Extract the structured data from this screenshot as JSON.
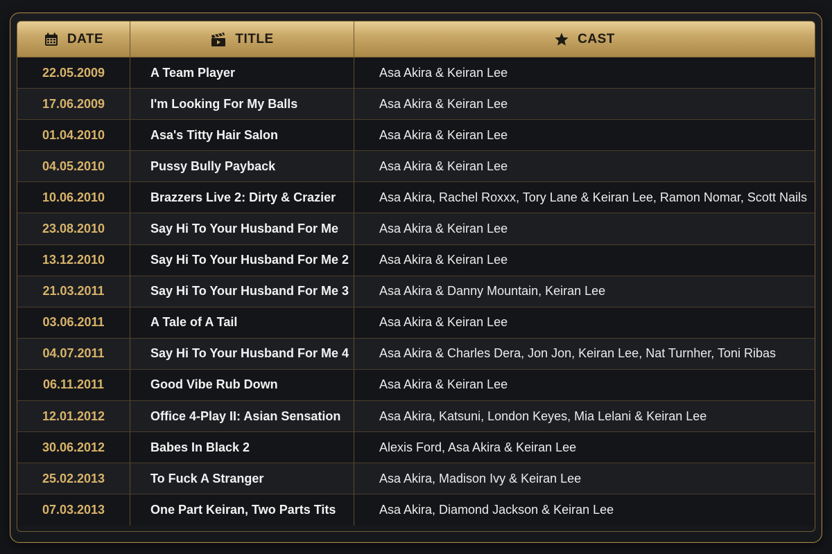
{
  "header": {
    "date_label": "DATE",
    "title_label": "TITLE",
    "cast_label": "CAST",
    "icons": {
      "date": "calendar-icon",
      "title": "clapperboard-icon",
      "cast": "star-icon"
    }
  },
  "colors": {
    "accent_gold": "#c9a868",
    "date_text": "#d8b46a",
    "background": "#15161a"
  },
  "rows": [
    {
      "date": "22.05.2009",
      "title": "A Team Player",
      "cast": "Asa Akira & Keiran Lee"
    },
    {
      "date": "17.06.2009",
      "title": "I'm Looking For My Balls",
      "cast": "Asa Akira & Keiran Lee"
    },
    {
      "date": "01.04.2010",
      "title": "Asa's Titty Hair Salon",
      "cast": "Asa Akira & Keiran Lee"
    },
    {
      "date": "04.05.2010",
      "title": "Pussy Bully Payback",
      "cast": "Asa Akira & Keiran Lee"
    },
    {
      "date": "10.06.2010",
      "title": "Brazzers Live 2: Dirty & Crazier",
      "cast": "Asa Akira, Rachel Roxxx, Tory Lane & Keiran Lee, Ramon Nomar, Scott Nails"
    },
    {
      "date": "23.08.2010",
      "title": "Say Hi To Your Husband For Me",
      "cast": "Asa Akira & Keiran Lee"
    },
    {
      "date": "13.12.2010",
      "title": "Say Hi To Your Husband For Me 2",
      "cast": "Asa Akira & Keiran Lee"
    },
    {
      "date": "21.03.2011",
      "title": "Say Hi To Your Husband For Me 3",
      "cast": "Asa Akira & Danny Mountain, Keiran Lee"
    },
    {
      "date": "03.06.2011",
      "title": "A Tale of A Tail",
      "cast": "Asa Akira & Keiran Lee"
    },
    {
      "date": "04.07.2011",
      "title": "Say Hi To Your Husband For Me 4",
      "cast": "Asa Akira & Charles Dera, Jon Jon, Keiran Lee, Nat Turnher, Toni Ribas"
    },
    {
      "date": "06.11.2011",
      "title": "Good Vibe Rub Down",
      "cast": "Asa Akira & Keiran Lee"
    },
    {
      "date": "12.01.2012",
      "title": "Office 4-Play II: Asian Sensation",
      "cast": "Asa Akira, Katsuni, London Keyes, Mia Lelani & Keiran Lee"
    },
    {
      "date": "30.06.2012",
      "title": "Babes In Black 2",
      "cast": "Alexis Ford, Asa Akira & Keiran Lee"
    },
    {
      "date": "25.02.2013",
      "title": "To Fuck A Stranger",
      "cast": "Asa Akira, Madison Ivy & Keiran Lee"
    },
    {
      "date": "07.03.2013",
      "title": "One Part Keiran, Two Parts Tits",
      "cast": "Asa Akira, Diamond Jackson & Keiran Lee"
    }
  ]
}
